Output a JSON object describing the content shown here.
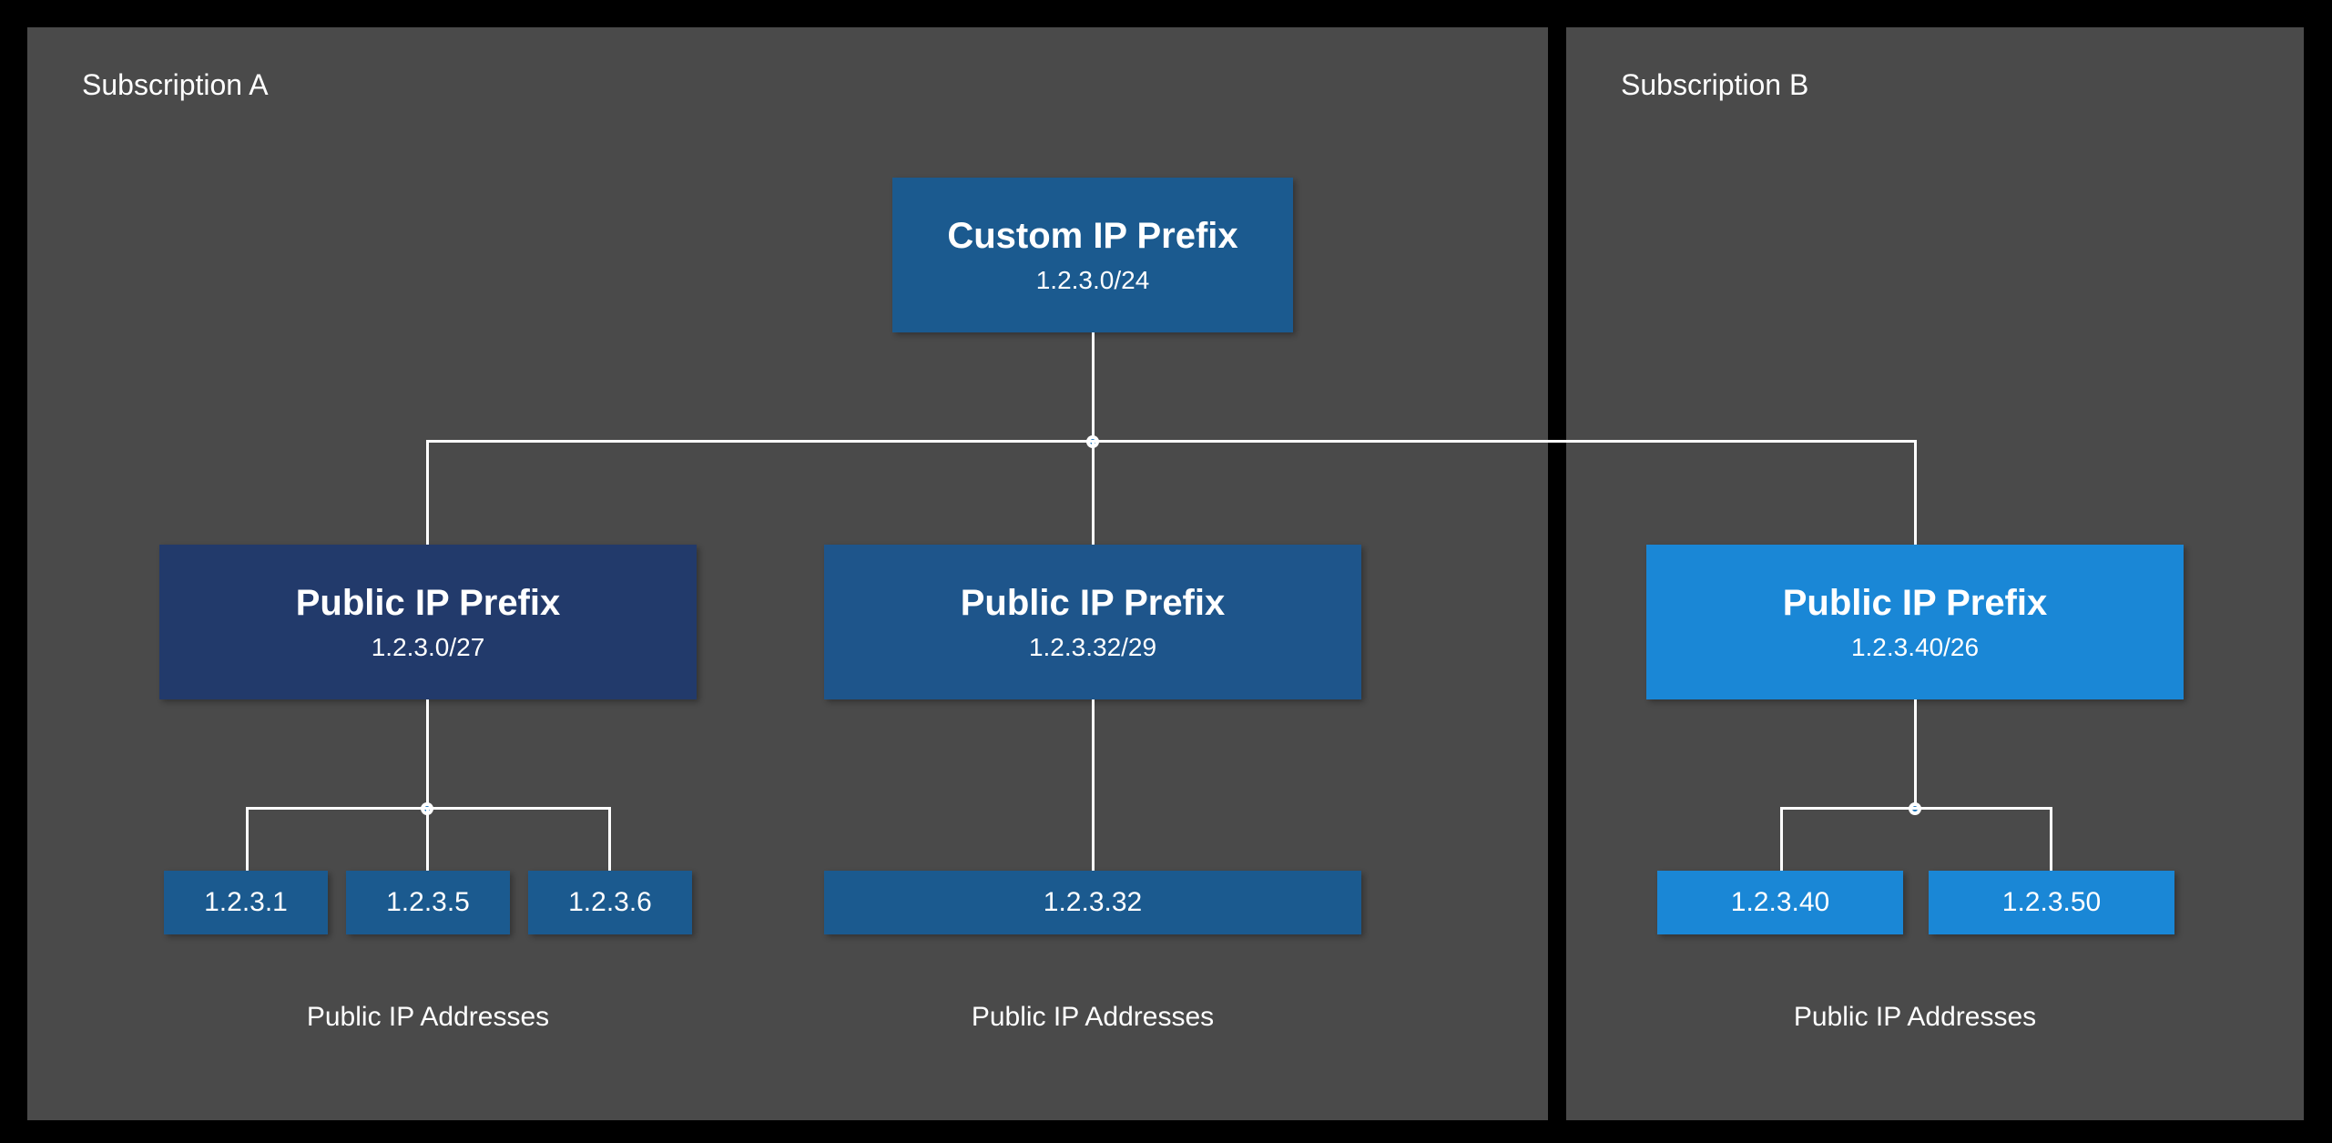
{
  "subscriptions": {
    "a": {
      "title": "Subscription A"
    },
    "b": {
      "title": "Subscription B"
    }
  },
  "custom_prefix": {
    "title": "Custom IP Prefix",
    "cidr": "1.2.3.0/24"
  },
  "public_prefixes": [
    {
      "title": "Public IP Prefix",
      "cidr": "1.2.3.0/27",
      "addresses_label": "Public IP Addresses",
      "ips": [
        "1.2.3.1",
        "1.2.3.5",
        "1.2.3.6"
      ]
    },
    {
      "title": "Public IP Prefix",
      "cidr": "1.2.3.32/29",
      "addresses_label": "Public IP Addresses",
      "ips": [
        "1.2.3.32"
      ]
    },
    {
      "title": "Public IP Prefix",
      "cidr": "1.2.3.40/26",
      "addresses_label": "Public IP Addresses",
      "ips": [
        "1.2.3.40",
        "1.2.3.50"
      ]
    }
  ]
}
